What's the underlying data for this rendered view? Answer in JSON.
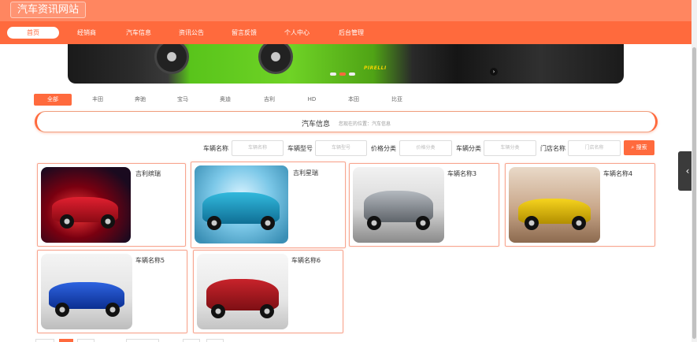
{
  "header": {
    "site_title": "汽车资讯网站"
  },
  "nav": {
    "items": [
      {
        "label": "首页",
        "active": true
      },
      {
        "label": "经销商",
        "active": false
      },
      {
        "label": "汽车信息",
        "active": false
      },
      {
        "label": "资讯公告",
        "active": false
      },
      {
        "label": "留言反馈",
        "active": false
      },
      {
        "label": "个人中心",
        "active": false
      },
      {
        "label": "后台管理",
        "active": false
      }
    ]
  },
  "banner": {
    "brand_text": "PIRELLI",
    "slides": 3,
    "current_slide": 2
  },
  "categories": {
    "items": [
      {
        "label": "全部",
        "active": true
      },
      {
        "label": "丰田"
      },
      {
        "label": "奔驰"
      },
      {
        "label": "宝马"
      },
      {
        "label": "奥迪"
      },
      {
        "label": "吉利"
      },
      {
        "label": "HD"
      },
      {
        "label": "本田"
      },
      {
        "label": "比亚"
      }
    ]
  },
  "section": {
    "title": "汽车信息",
    "subtitle": "您现在的位置：汽车信息"
  },
  "search": {
    "fields": [
      {
        "label": "车辆名称",
        "placeholder": "车辆名称"
      },
      {
        "label": "车辆型号",
        "placeholder": "车辆型号"
      },
      {
        "label": "价格分类",
        "placeholder": "价格分类"
      },
      {
        "label": "车辆分类",
        "placeholder": "车辆分类"
      },
      {
        "label": "门店名称",
        "placeholder": "门店名称"
      }
    ],
    "button_label": "搜索",
    "button_icon": "search-icon"
  },
  "cars": [
    {
      "name": "吉利缤瑞",
      "color": "#c8102e"
    },
    {
      "name": "吉利星瑞",
      "color": "#1aa3c9"
    },
    {
      "name": "车辆名称3",
      "color": "#8a8f96"
    },
    {
      "name": "车辆名称4",
      "color": "#e8c21a"
    },
    {
      "name": "车辆名称5",
      "color": "#1a4fc9"
    },
    {
      "name": "车辆名称6",
      "color": "#b3191f"
    }
  ],
  "colors": {
    "accent": "#ff6a3d",
    "topbar": "#ff8660"
  }
}
